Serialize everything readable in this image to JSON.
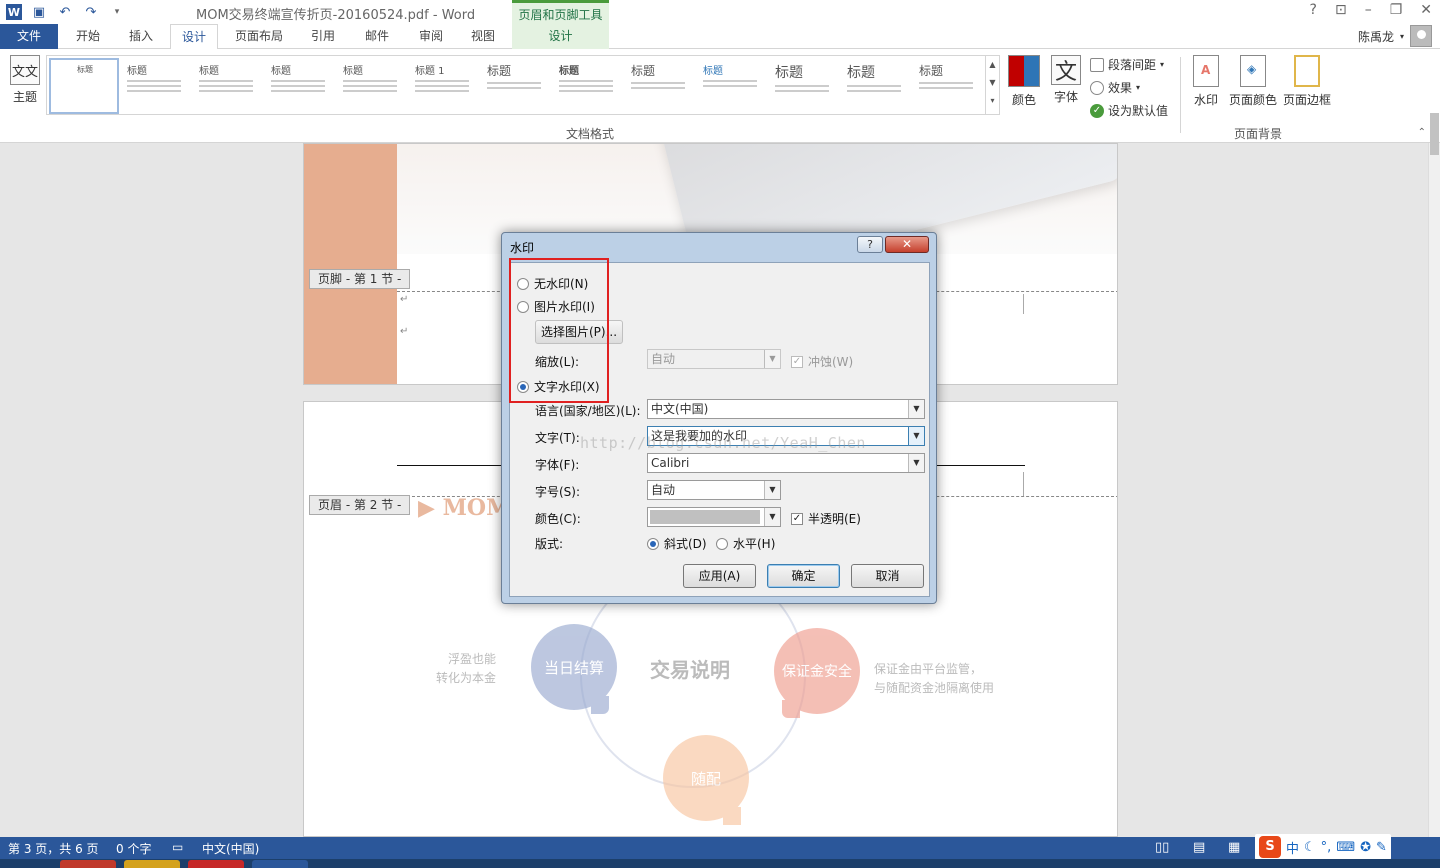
{
  "app": {
    "doc_title": "MOM交易终端宣传折页-20160524.pdf - Word",
    "contextual_tool": "页眉和页脚工具",
    "user": "陈禹龙"
  },
  "tabs": [
    "文件",
    "开始",
    "插入",
    "设计",
    "页面布局",
    "引用",
    "邮件",
    "审阅",
    "视图",
    "设计"
  ],
  "ribbon": {
    "theme_label": "主题",
    "theme_icon": "文文",
    "gallery_heading": "标题",
    "gallery_sub": "标题 1",
    "gallery_group": "文档格式",
    "colors_label": "颜色",
    "fonts_label": "字体",
    "fonts_icon": "文",
    "para_spacing": "段落间距",
    "effects": "效果",
    "set_default": "设为默认值",
    "watermark": "水印",
    "page_color": "页面颜色",
    "page_border": "页面边框",
    "bg_group": "页面背景"
  },
  "document": {
    "footer_tag": "页脚 - 第 1 节 -",
    "header_tag": "页眉 - 第 2 节 -",
    "logo_text": "▶ MOM",
    "center_title": "交易说明",
    "bubble_settle": "当日结算",
    "bubble_margin": "保证金安全",
    "bubble_any": "随配",
    "left_text_1": "浮盈也能",
    "left_text_2": "转化为本金",
    "right_text_1": "保证金由平台监管，",
    "right_text_2": "与随配资金池隔离使用",
    "url_watermark": "http://blog.csdn.net/YeaH_Chen",
    "para_mark": "↵"
  },
  "dialog": {
    "title": "水印",
    "help": "?",
    "close": "✕",
    "no_watermark": "无水印(N)",
    "picture_watermark": "图片水印(I)",
    "select_picture": "选择图片(P)...",
    "scale_label": "缩放(L):",
    "scale_value": "自动",
    "washout": "冲蚀(W)",
    "text_watermark": "文字水印(X)",
    "language_label": "语言(国家/地区)(L):",
    "language_value": "中文(中国)",
    "text_label": "文字(T):",
    "text_value": "这是我要加的水印",
    "font_label": "字体(F):",
    "font_value": "Calibri",
    "size_label": "字号(S):",
    "size_value": "自动",
    "color_label": "颜色(C):",
    "semi_transparent": "半透明(E)",
    "layout_label": "版式:",
    "diagonal": "斜式(D)",
    "horizontal": "水平(H)",
    "apply": "应用(A)",
    "ok": "确定",
    "cancel": "取消"
  },
  "status": {
    "page": "第 3 页，共 6 页",
    "words": "0 个字",
    "language": "中文(中国)"
  },
  "ime": {
    "logo": "S",
    "mode": "中"
  },
  "colors": {
    "word_blue": "#2b579a",
    "accent_orange": "#e6ad8f",
    "highlight_red": "#e02020"
  }
}
